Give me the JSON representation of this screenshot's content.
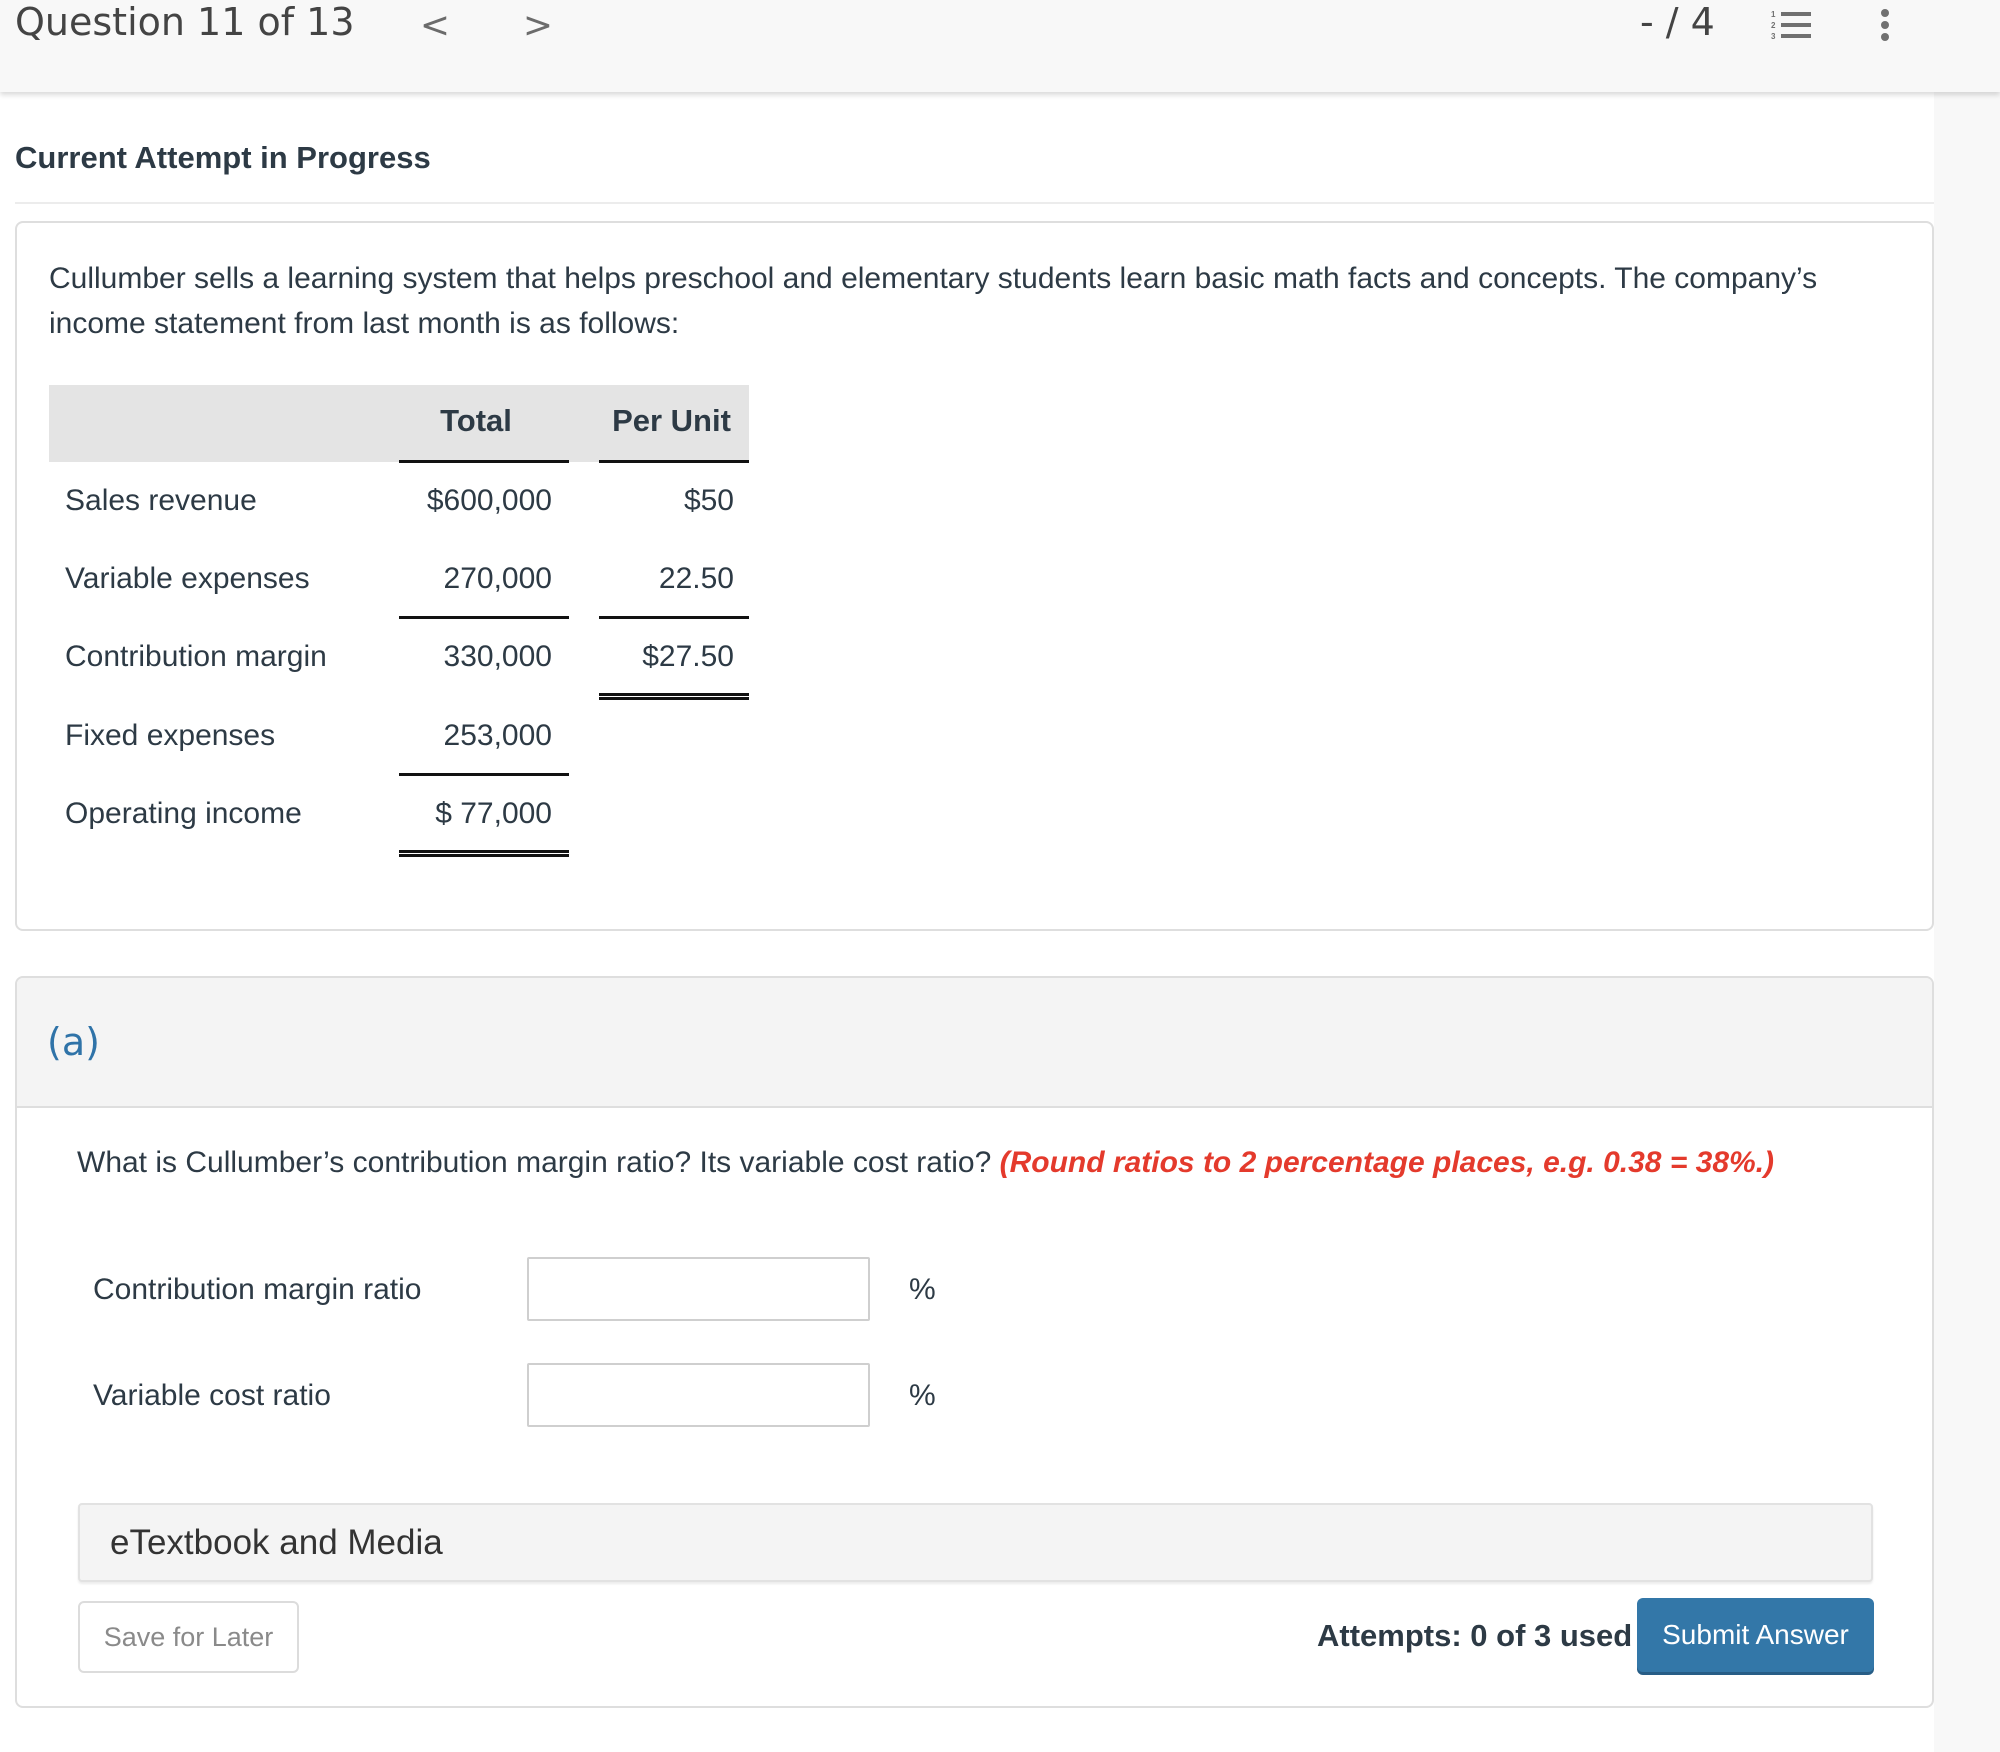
{
  "header": {
    "question_counter": "Question 11 of 13",
    "prev_icon": "chevron-left-icon",
    "next_icon": "chevron-right-icon",
    "prev_glyph": "<",
    "next_glyph": ">",
    "score": "- / 4",
    "list_icon": "numbered-list-icon",
    "more_icon": "more-vertical-icon"
  },
  "attempt_title": "Current Attempt in Progress",
  "problem": {
    "text": "Cullumber sells a learning system that helps preschool and elementary students learn basic math facts and concepts. The company’s income statement from last month is as follows:",
    "table": {
      "columns": [
        "",
        "Total",
        "Per Unit"
      ],
      "rows": [
        {
          "label": "Sales revenue",
          "total": "$600,000",
          "per_unit": "$50"
        },
        {
          "label": "Variable expenses",
          "total": "270,000",
          "per_unit": "22.50"
        },
        {
          "label": "Contribution margin",
          "total": "330,000",
          "per_unit": "$27.50"
        },
        {
          "label": "Fixed expenses",
          "total": "253,000",
          "per_unit": ""
        },
        {
          "label": "Operating income",
          "total": "$ 77,000",
          "per_unit": ""
        }
      ]
    }
  },
  "part_a": {
    "label": "(a)",
    "question": "What is Cullumber’s contribution margin ratio? Its variable cost ratio? ",
    "hint": "(Round ratios to 2 percentage places, e.g. 0.38 = 38%.)",
    "fields": [
      {
        "label": "Contribution margin ratio",
        "value": "",
        "unit": "%"
      },
      {
        "label": "Variable cost ratio",
        "value": "",
        "unit": "%"
      }
    ],
    "etextbook_label": "eTextbook and Media",
    "save_label": "Save for Later",
    "attempts_text": "Attempts: 0 of 3 used",
    "submit_label": "Submit Answer"
  },
  "colors": {
    "accent": "#3377a8",
    "hint": "#e43a2c",
    "part_label": "#2f73a8"
  }
}
